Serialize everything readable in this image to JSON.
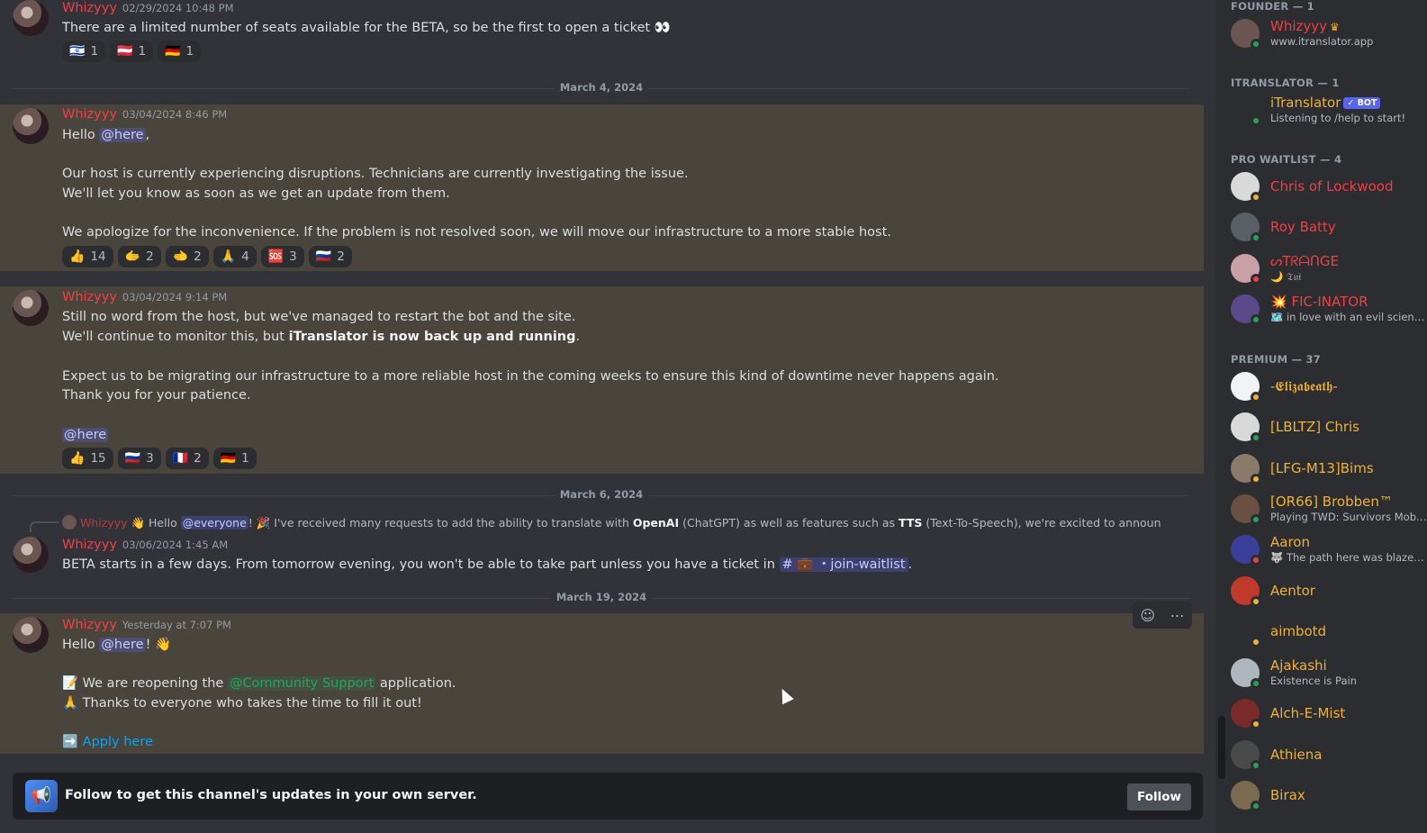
{
  "messages": {
    "m1": {
      "author": "Whizyyy",
      "time": "02/29/2024 10:48 PM",
      "text": "There are a limited number of seats available for the BETA, so be the first to open a ticket 👀",
      "reactions": [
        {
          "emoji": "🇮🇱",
          "count": "1"
        },
        {
          "emoji": "🇦🇹",
          "count": "1"
        },
        {
          "emoji": "🇩🇪",
          "count": "1"
        }
      ]
    },
    "divider1": "March 4, 2024",
    "m2": {
      "author": "Whizyyy",
      "time": "03/04/2024 8:46 PM",
      "hello": "Hello ",
      "mention": "@here",
      "comma": ",",
      "l1": "Our host is currently experiencing disruptions. Technicians are currently investigating the issue.",
      "l2": "We'll let you know as soon as we get an update from them.",
      "l3": "We apologize for the inconvenience. If the problem is not resolved soon, we will move our infrastructure to a more stable host.",
      "reactions": [
        {
          "emoji": "👍",
          "count": "14"
        },
        {
          "emoji": "🫱",
          "count": "2"
        },
        {
          "emoji": "🫲",
          "count": "2"
        },
        {
          "emoji": "🙏",
          "count": "4"
        },
        {
          "emoji": "🆘",
          "count": "3"
        },
        {
          "emoji": "🇷🇺",
          "count": "2"
        }
      ]
    },
    "m3": {
      "author": "Whizyyy",
      "time": "03/04/2024 9:14 PM",
      "l1": "Still no word from the host, but we've managed to restart the bot and the site.",
      "l2a": "We'll continue to monitor this, but ",
      "l2b": "iTranslator is now back up and running",
      "l2c": ".",
      "l3": "Expect us to be migrating our infrastructure to a more reliable host in the coming weeks to ensure this kind of downtime never happens again.",
      "l4": "Thank you for your patience.",
      "mention": "@here",
      "reactions": [
        {
          "emoji": "👍",
          "count": "15"
        },
        {
          "emoji": "🇷🇺",
          "count": "3"
        },
        {
          "emoji": "🇫🇷",
          "count": "2"
        },
        {
          "emoji": "🇩🇪",
          "count": "1"
        }
      ]
    },
    "divider2": "March 6, 2024",
    "m4": {
      "reply_author": "Whizyyy",
      "reply_a": "👋 Hello ",
      "reply_mention": "@everyone",
      "reply_b": "! 🎉 I've received many requests to add the ability to translate with ",
      "reply_c": "OpenAI",
      "reply_d": " (ChatGPT) as well as features such as ",
      "reply_e": "TTS",
      "reply_f": " (Text-To-Speech), we're excited to announce that decide",
      "author": "Whizyyy",
      "time": "03/06/2024 1:45 AM",
      "text_a": "BETA starts in a few days. From tomorrow evening, you won't be able to take part unless you have a ticket in ",
      "channel": "# 💼 ・join-waitlist",
      "text_b": "."
    },
    "divider3": "March 19, 2024",
    "m5": {
      "author": "Whizyyy",
      "time": "Yesterday at 7:07 PM",
      "hello": "Hello ",
      "mention": "@here",
      "wave": "! 👋",
      "l1a": "📝 We are reopening the ",
      "role": "@Community Support",
      "l1b": " application.",
      "l2": "🙏 Thanks to everyone who takes the time to fill it out!",
      "link_icon": "➡️",
      "link": "Apply here"
    }
  },
  "follow": {
    "text": "Follow to get this channel's updates in your own server.",
    "button": "Follow"
  },
  "members": {
    "groups": [
      {
        "label": "FOUNDER — 1"
      },
      {
        "label": "ITRANSLATOR — 1"
      },
      {
        "label": "PRO WAITLIST — 4"
      },
      {
        "label": "PREMIUM — 37"
      }
    ],
    "list": [
      {
        "name": "Whizyyy",
        "sub": "www.itranslator.app",
        "color": "#f23f43",
        "status": "online",
        "avatar": "#6b5552"
      },
      {
        "name": "iTranslator",
        "tag": "✓ BOT",
        "sub": "Listening to /help to start!",
        "color": "#f0b232",
        "status": "online",
        "avatar": "#2b2d31"
      },
      {
        "name": "Chris of Lockwood",
        "sub": "",
        "color": "#f23f43",
        "status": "idle",
        "avatar": "#d9d9d9"
      },
      {
        "name": "Roy Batty",
        "sub": "",
        "color": "#f23f43",
        "status": "online",
        "avatar": "#5a5f66"
      },
      {
        "name": "ᔕTᖇᗩᑎGE",
        "sub": "🌙 𝔗𝔲𝔦",
        "color": "#f23f43",
        "status": "dnd",
        "avatar": "#c9a0a8"
      },
      {
        "name": "💥 FIC-INATOR",
        "sub": "🗺️ in love with an evil scientist",
        "color": "#f23f43",
        "status": "online",
        "avatar": "#5b4a8a"
      },
      {
        "name": "-𝕰𝖑𝖎𝖟𝖆𝖇𝖊𝖆𝖙𝖍-",
        "sub": "",
        "color": "#f0b232",
        "status": "idle",
        "avatar": "#f2f3f5"
      },
      {
        "name": "[LBLTZ] Chris",
        "sub": "",
        "color": "#f0b232",
        "status": "online",
        "avatar": "#d9d9d9"
      },
      {
        "name": "[LFG-M13]Bims",
        "sub": "",
        "color": "#f0b232",
        "status": "idle",
        "avatar": "#8a7a6a"
      },
      {
        "name": "[OR66] Brobben™",
        "sub": "Playing TWD: Survivors Mobil...",
        "color": "#f0b232",
        "status": "online",
        "avatar": "#6a5040"
      },
      {
        "name": "Aaron",
        "sub": "🐺 The path here was blazed ...",
        "color": "#f0b232",
        "status": "dnd",
        "avatar": "#3a3f9a"
      },
      {
        "name": "Aentor",
        "sub": "",
        "color": "#f0b232",
        "status": "idle",
        "avatar": "#c0392b"
      },
      {
        "name": "aimbotd",
        "sub": "",
        "color": "#f0b232",
        "status": "idle",
        "avatar": "#2b2d31"
      },
      {
        "name": "Ajakashi",
        "sub": "Existence is Pain",
        "color": "#f0b232",
        "status": "online",
        "avatar": "#b0b6be"
      },
      {
        "name": "Alch-E-Mist",
        "sub": "",
        "color": "#f0b232",
        "status": "idle",
        "avatar": "#7a2a2a"
      },
      {
        "name": "Athiena",
        "sub": "",
        "color": "#f0b232",
        "status": "online",
        "avatar": "#4a4a4a"
      },
      {
        "name": "Birax",
        "sub": "",
        "color": "#f0b232",
        "status": "online",
        "avatar": "#7a6a50"
      }
    ]
  }
}
